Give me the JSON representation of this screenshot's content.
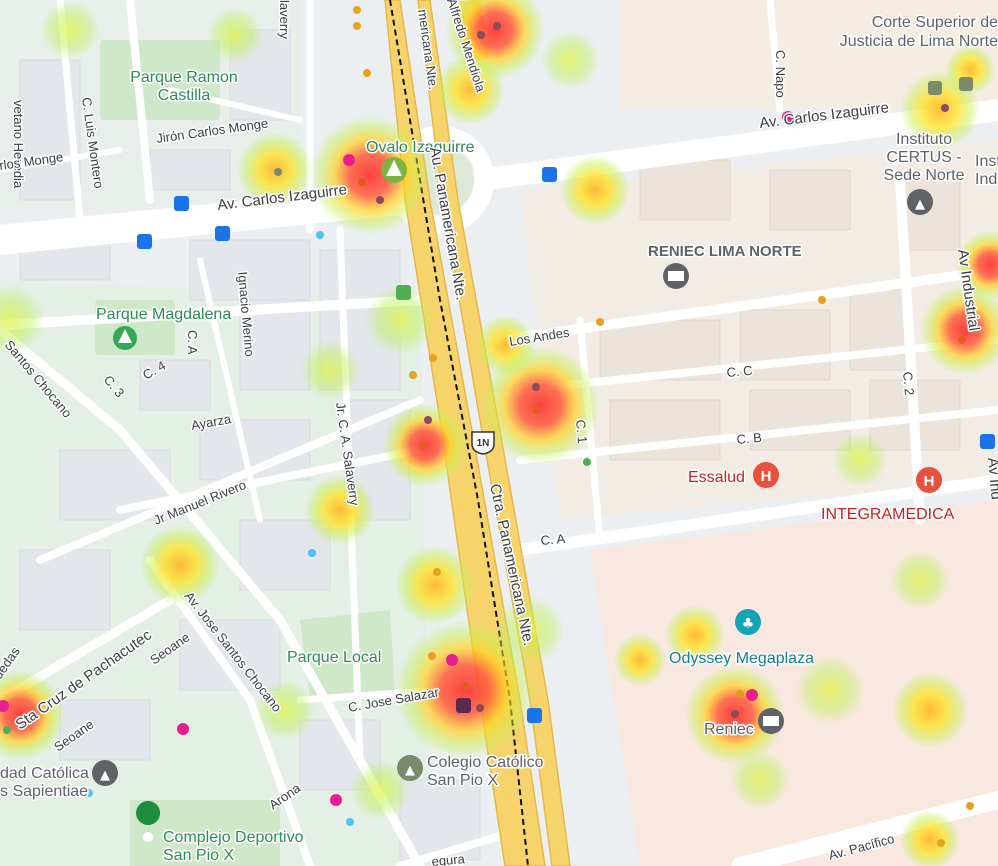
{
  "places": {
    "corte_line1": "Corte Superior de",
    "corte_line2": "Justicia de Lima Norte",
    "parque_ramon_line1": "Parque Ramon",
    "parque_ramon_line2": "Castilla",
    "ovalo": "Ovalo Izaguirre",
    "instituto_line1": "Instituto",
    "instituto_line2": "CERTUS -",
    "instituto_line3": "Sede Norte",
    "reniec_norte": "RENIEC LIMA NORTE",
    "parque_magdalena": "Parque Magdalena",
    "essalud": "Essalud",
    "integramedica": "INTEGRAMEDICA",
    "odyssey": "Odyssey Megaplaza",
    "reniec": "Reniec",
    "parque_local": "Parque Local",
    "colegio_line1": "Colegio Católico",
    "colegio_line2": "San Pio X",
    "complejo_line1": "Complejo Deportivo",
    "complejo_line2": "San Pio X",
    "catolica_line1": "dad Católica",
    "catolica_line2": "s Sapientiae",
    "indu_partial1": "Insti",
    "indu_partial2": "Indu"
  },
  "streets": {
    "heredia": "vetano Heredia",
    "alfredo": "Alfredo Mendiola",
    "pan_norte_top": "Au. Panamericana Nte.",
    "pan_norte_partial": "mericana Nte.",
    "pan_norte_mid": "Au. Panamericana Nte.",
    "ctra": "Ctra. Panamericana Nte.",
    "carlos_west": "Av. Carlos Izaguirre",
    "carlos_east": "Av. Carlos Izaguirre",
    "jiron_monge": "Jirón Carlos Monge",
    "monge_left": "rlos Monge",
    "luis_montero": "C. Luis Montero",
    "napo": "C. Napo",
    "salaverry_top": "laverry",
    "los_andes": "Los Andes",
    "c_a_left": "C. A",
    "ignacio": "Ignacio Merino",
    "c4": "C. 4",
    "c3": "C. 3",
    "santos_chocano": "Santos Chocano",
    "ayarza": "Ayarza",
    "jr_salaverry": "Jr. C. A. Salaverry",
    "manuel_rivero": "Jr Manuel Rivero",
    "cc": "C. C",
    "cb": "C. B",
    "ca_right": "C. A",
    "c1": "C. 1",
    "c2": "C. 2",
    "av_industrial": "Av Industrial",
    "av_ind_partial": "Av Ind",
    "pachacutec": "Sta Cruz de Pachacutec",
    "seoane1": "Seoane",
    "seoane2": "Seoane",
    "av_jose_santos": "Av. Jose Santos Chocano",
    "jose_salazar": "C. Jose Salazar",
    "arona": "Arona",
    "av_pacifico": "Av. Pacífico",
    "quedas": "uedas",
    "segura": "egura"
  },
  "shield": "1N",
  "colors": {
    "heat_red": "#ff3b3b",
    "heat_yellow": "#ffe600",
    "heat_green": "#a8e84a",
    "highway": "#f7d36b",
    "park_label": "#2e8b57",
    "medical": "#d93025",
    "transit": "#1a73e8"
  }
}
